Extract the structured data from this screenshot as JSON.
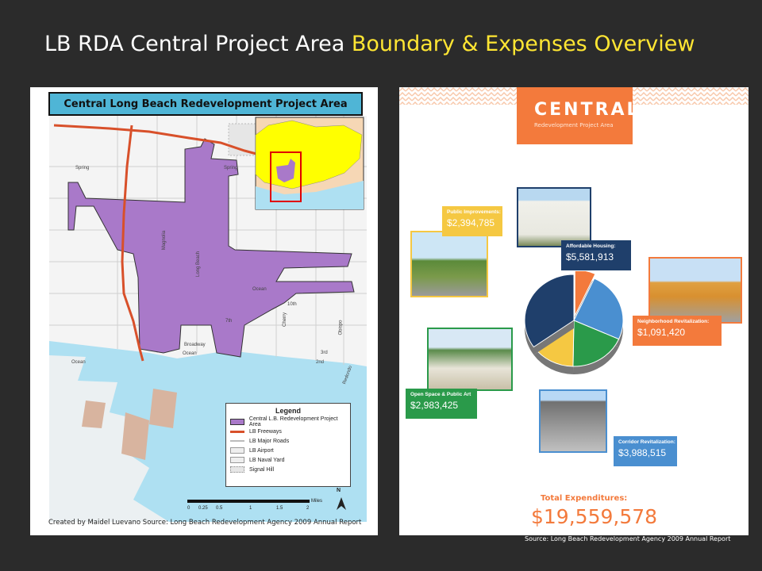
{
  "slide": {
    "title_main": "LB RDA Central Project Area",
    "title_highlight": "Boundary & Expenses Overview"
  },
  "map": {
    "banner": "Central Long Beach Redevelopment Project Area",
    "credit": "Created by Maidel Luevano Source: Long Beach Redevelopment Agency 2009 Annual Report",
    "road_labels": [
      "Spring",
      "Spring",
      "Magnolia",
      "Long Beach",
      "Ocean",
      "Broadway",
      "Ocean",
      "10th",
      "7th",
      "3rd",
      "2nd",
      "Cherry",
      "Obispo",
      "Redondo",
      "Ocean"
    ],
    "legend": {
      "title": "Legend",
      "items": [
        {
          "label": "Central L.B. Redevelopment Project Area",
          "color": "#a979c9"
        },
        {
          "label": "LB Freeways",
          "color": "#d8502a"
        },
        {
          "label": "LB Major Roads",
          "color": "#bbbbbb"
        },
        {
          "label": "LB Airport",
          "color": "#dddddd"
        },
        {
          "label": "LB Naval Yard",
          "color": "#dddddd"
        },
        {
          "label": "Signal Hill",
          "color": "#dddddd"
        }
      ]
    },
    "scale": {
      "ticks": [
        "0",
        "0.25",
        "0.5",
        "1",
        "1.5",
        "2"
      ],
      "unit": "Miles"
    },
    "north": "N"
  },
  "infographic": {
    "header_big": "CENTRAL",
    "header_small": "Redevelopment Project Area",
    "categories": [
      {
        "label": "Public Improvements:",
        "value": "$2,394,785",
        "color": "#f5c842"
      },
      {
        "label": "Affordable Housing:",
        "value": "$5,581,913",
        "color": "#1f3f6b"
      },
      {
        "label": "Neighborhood Revitalization:",
        "value": "$1,091,420",
        "color": "#f37a3c"
      },
      {
        "label": "Open Space & Public Art",
        "value": "$2,983,425",
        "color": "#2a9a4a"
      },
      {
        "label": "Corridor Revitalization:",
        "value": "$3,988,515",
        "color": "#4a8fd0"
      }
    ],
    "total_label": "Total Expenditures:",
    "total_value": "$19,559,578"
  },
  "source_note": "Source: Long Beach Redevelopment Agency 2009 Annual Report"
}
